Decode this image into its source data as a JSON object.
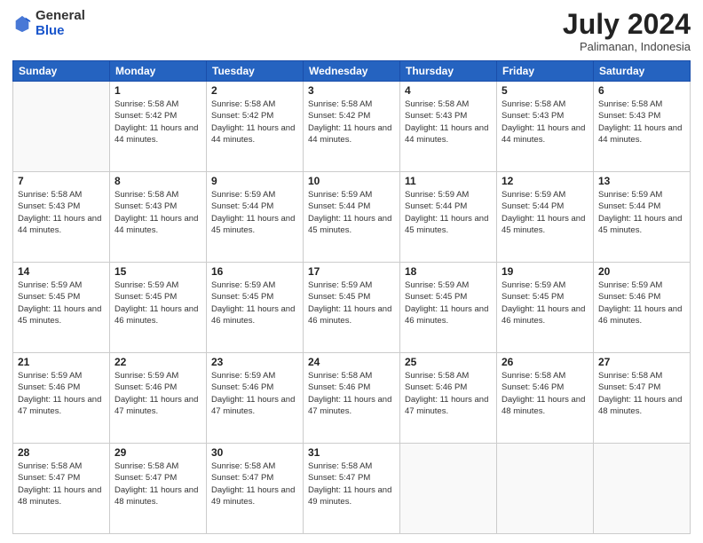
{
  "header": {
    "logo": {
      "general": "General",
      "blue": "Blue"
    },
    "title": "July 2024",
    "location": "Palimanan, Indonesia"
  },
  "days_of_week": [
    "Sunday",
    "Monday",
    "Tuesday",
    "Wednesday",
    "Thursday",
    "Friday",
    "Saturday"
  ],
  "weeks": [
    [
      {
        "day": null
      },
      {
        "day": 1,
        "sunrise": "5:58 AM",
        "sunset": "5:42 PM",
        "daylight": "11 hours and 44 minutes."
      },
      {
        "day": 2,
        "sunrise": "5:58 AM",
        "sunset": "5:42 PM",
        "daylight": "11 hours and 44 minutes."
      },
      {
        "day": 3,
        "sunrise": "5:58 AM",
        "sunset": "5:42 PM",
        "daylight": "11 hours and 44 minutes."
      },
      {
        "day": 4,
        "sunrise": "5:58 AM",
        "sunset": "5:43 PM",
        "daylight": "11 hours and 44 minutes."
      },
      {
        "day": 5,
        "sunrise": "5:58 AM",
        "sunset": "5:43 PM",
        "daylight": "11 hours and 44 minutes."
      },
      {
        "day": 6,
        "sunrise": "5:58 AM",
        "sunset": "5:43 PM",
        "daylight": "11 hours and 44 minutes."
      }
    ],
    [
      {
        "day": 7,
        "sunrise": "5:58 AM",
        "sunset": "5:43 PM",
        "daylight": "11 hours and 44 minutes."
      },
      {
        "day": 8,
        "sunrise": "5:58 AM",
        "sunset": "5:43 PM",
        "daylight": "11 hours and 44 minutes."
      },
      {
        "day": 9,
        "sunrise": "5:59 AM",
        "sunset": "5:44 PM",
        "daylight": "11 hours and 45 minutes."
      },
      {
        "day": 10,
        "sunrise": "5:59 AM",
        "sunset": "5:44 PM",
        "daylight": "11 hours and 45 minutes."
      },
      {
        "day": 11,
        "sunrise": "5:59 AM",
        "sunset": "5:44 PM",
        "daylight": "11 hours and 45 minutes."
      },
      {
        "day": 12,
        "sunrise": "5:59 AM",
        "sunset": "5:44 PM",
        "daylight": "11 hours and 45 minutes."
      },
      {
        "day": 13,
        "sunrise": "5:59 AM",
        "sunset": "5:44 PM",
        "daylight": "11 hours and 45 minutes."
      }
    ],
    [
      {
        "day": 14,
        "sunrise": "5:59 AM",
        "sunset": "5:45 PM",
        "daylight": "11 hours and 45 minutes."
      },
      {
        "day": 15,
        "sunrise": "5:59 AM",
        "sunset": "5:45 PM",
        "daylight": "11 hours and 46 minutes."
      },
      {
        "day": 16,
        "sunrise": "5:59 AM",
        "sunset": "5:45 PM",
        "daylight": "11 hours and 46 minutes."
      },
      {
        "day": 17,
        "sunrise": "5:59 AM",
        "sunset": "5:45 PM",
        "daylight": "11 hours and 46 minutes."
      },
      {
        "day": 18,
        "sunrise": "5:59 AM",
        "sunset": "5:45 PM",
        "daylight": "11 hours and 46 minutes."
      },
      {
        "day": 19,
        "sunrise": "5:59 AM",
        "sunset": "5:45 PM",
        "daylight": "11 hours and 46 minutes."
      },
      {
        "day": 20,
        "sunrise": "5:59 AM",
        "sunset": "5:46 PM",
        "daylight": "11 hours and 46 minutes."
      }
    ],
    [
      {
        "day": 21,
        "sunrise": "5:59 AM",
        "sunset": "5:46 PM",
        "daylight": "11 hours and 47 minutes."
      },
      {
        "day": 22,
        "sunrise": "5:59 AM",
        "sunset": "5:46 PM",
        "daylight": "11 hours and 47 minutes."
      },
      {
        "day": 23,
        "sunrise": "5:59 AM",
        "sunset": "5:46 PM",
        "daylight": "11 hours and 47 minutes."
      },
      {
        "day": 24,
        "sunrise": "5:58 AM",
        "sunset": "5:46 PM",
        "daylight": "11 hours and 47 minutes."
      },
      {
        "day": 25,
        "sunrise": "5:58 AM",
        "sunset": "5:46 PM",
        "daylight": "11 hours and 47 minutes."
      },
      {
        "day": 26,
        "sunrise": "5:58 AM",
        "sunset": "5:46 PM",
        "daylight": "11 hours and 48 minutes."
      },
      {
        "day": 27,
        "sunrise": "5:58 AM",
        "sunset": "5:47 PM",
        "daylight": "11 hours and 48 minutes."
      }
    ],
    [
      {
        "day": 28,
        "sunrise": "5:58 AM",
        "sunset": "5:47 PM",
        "daylight": "11 hours and 48 minutes."
      },
      {
        "day": 29,
        "sunrise": "5:58 AM",
        "sunset": "5:47 PM",
        "daylight": "11 hours and 48 minutes."
      },
      {
        "day": 30,
        "sunrise": "5:58 AM",
        "sunset": "5:47 PM",
        "daylight": "11 hours and 49 minutes."
      },
      {
        "day": 31,
        "sunrise": "5:58 AM",
        "sunset": "5:47 PM",
        "daylight": "11 hours and 49 minutes."
      },
      {
        "day": null
      },
      {
        "day": null
      },
      {
        "day": null
      }
    ]
  ]
}
